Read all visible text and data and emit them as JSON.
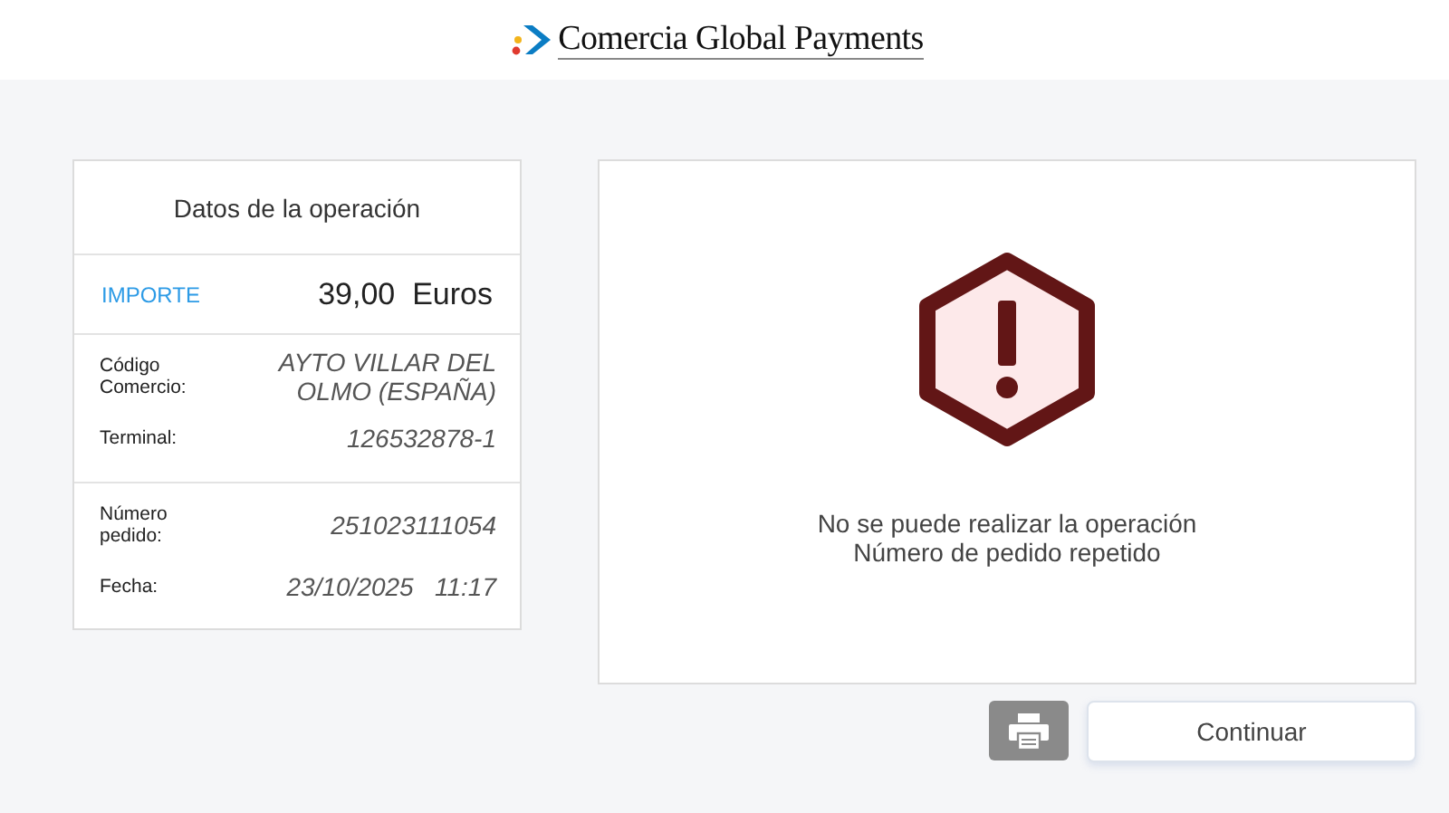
{
  "header": {
    "brand": "Comercia Global Payments"
  },
  "operation": {
    "title": "Datos de la operación",
    "amount_label": "IMPORTE",
    "amount": "39,00  Euros",
    "groups": [
      {
        "fields": [
          {
            "label": "Código Comercio:",
            "value": "AYTO VILLAR DEL OLMO (ESPAÑA)"
          },
          {
            "label": "Terminal:",
            "value": "126532878-1"
          }
        ]
      },
      {
        "fields": [
          {
            "label": "Número pedido:",
            "value": "251023111054"
          },
          {
            "label": "Fecha:",
            "value": "23/10/2025   11:17"
          }
        ]
      }
    ]
  },
  "message": {
    "lines": [
      "No se puede realizar la operación",
      "Número de pedido repetido"
    ]
  },
  "buttons": {
    "continue": "Continuar"
  }
}
